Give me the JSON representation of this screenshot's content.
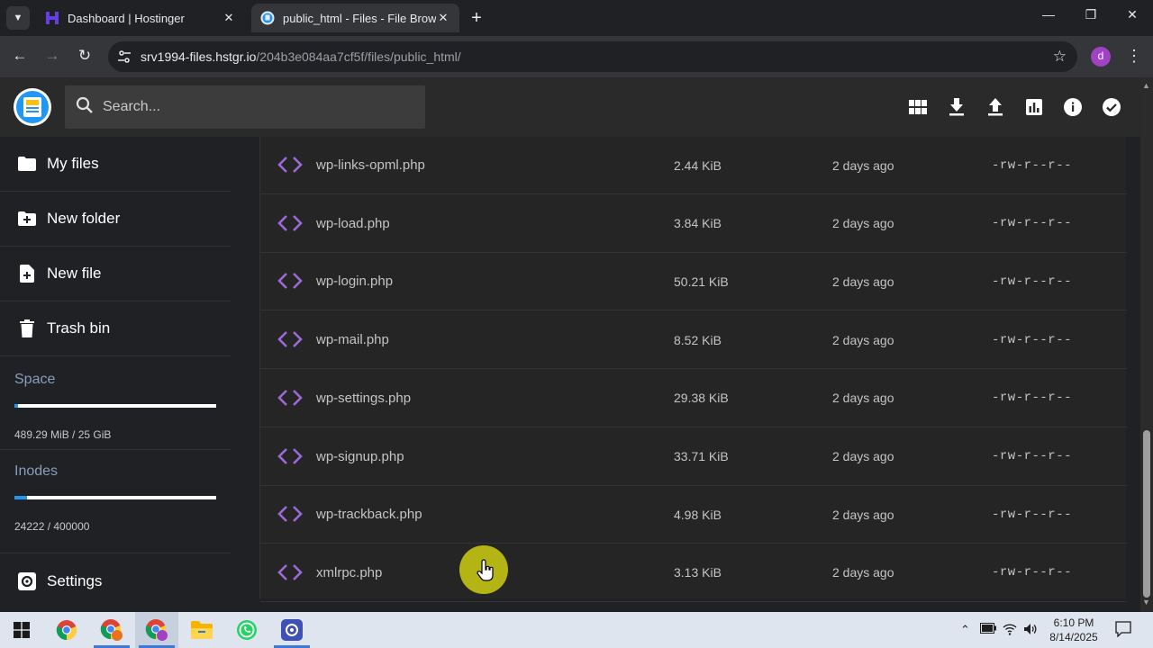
{
  "browser": {
    "tabs": [
      {
        "title": "Dashboard | Hostinger",
        "active": false
      },
      {
        "title": "public_html - Files - File Browser",
        "active": true
      }
    ],
    "url_host": "srv1994-files.hstgr.io",
    "url_path": "/204b3e084aa7cf5f/files/public_html/",
    "profile_initial": "d"
  },
  "header": {
    "search_placeholder": "Search..."
  },
  "sidebar": {
    "items": [
      {
        "label": "My files",
        "icon": "folder-icon"
      },
      {
        "label": "New folder",
        "icon": "create-new-folder-icon"
      },
      {
        "label": "New file",
        "icon": "note-add-icon"
      },
      {
        "label": "Trash bin",
        "icon": "trash-icon"
      }
    ],
    "space": {
      "label": "Space",
      "value": "489.29 MiB / 25 GiB",
      "fraction": 0.019
    },
    "inodes": {
      "label": "Inodes",
      "value": "24222 / 400000",
      "fraction": 0.061
    },
    "settings_label": "Settings"
  },
  "files": [
    {
      "name": "wp-links-opml.php",
      "size": "2.44 KiB",
      "modified": "2 days ago",
      "perms": "-rw-r--r--"
    },
    {
      "name": "wp-load.php",
      "size": "3.84 KiB",
      "modified": "2 days ago",
      "perms": "-rw-r--r--"
    },
    {
      "name": "wp-login.php",
      "size": "50.21 KiB",
      "modified": "2 days ago",
      "perms": "-rw-r--r--"
    },
    {
      "name": "wp-mail.php",
      "size": "8.52 KiB",
      "modified": "2 days ago",
      "perms": "-rw-r--r--"
    },
    {
      "name": "wp-settings.php",
      "size": "29.38 KiB",
      "modified": "2 days ago",
      "perms": "-rw-r--r--"
    },
    {
      "name": "wp-signup.php",
      "size": "33.71 KiB",
      "modified": "2 days ago",
      "perms": "-rw-r--r--"
    },
    {
      "name": "wp-trackback.php",
      "size": "4.98 KiB",
      "modified": "2 days ago",
      "perms": "-rw-r--r--"
    },
    {
      "name": "xmlrpc.php",
      "size": "3.13 KiB",
      "modified": "2 days ago",
      "perms": "-rw-r--r--"
    }
  ],
  "taskbar": {
    "time": "6:10 PM",
    "date": "8/14/2025"
  },
  "colors": {
    "accent_blue": "#2196f3",
    "code_icon_purple": "#9c6ad6",
    "cursor_highlight": "#c4c414"
  }
}
